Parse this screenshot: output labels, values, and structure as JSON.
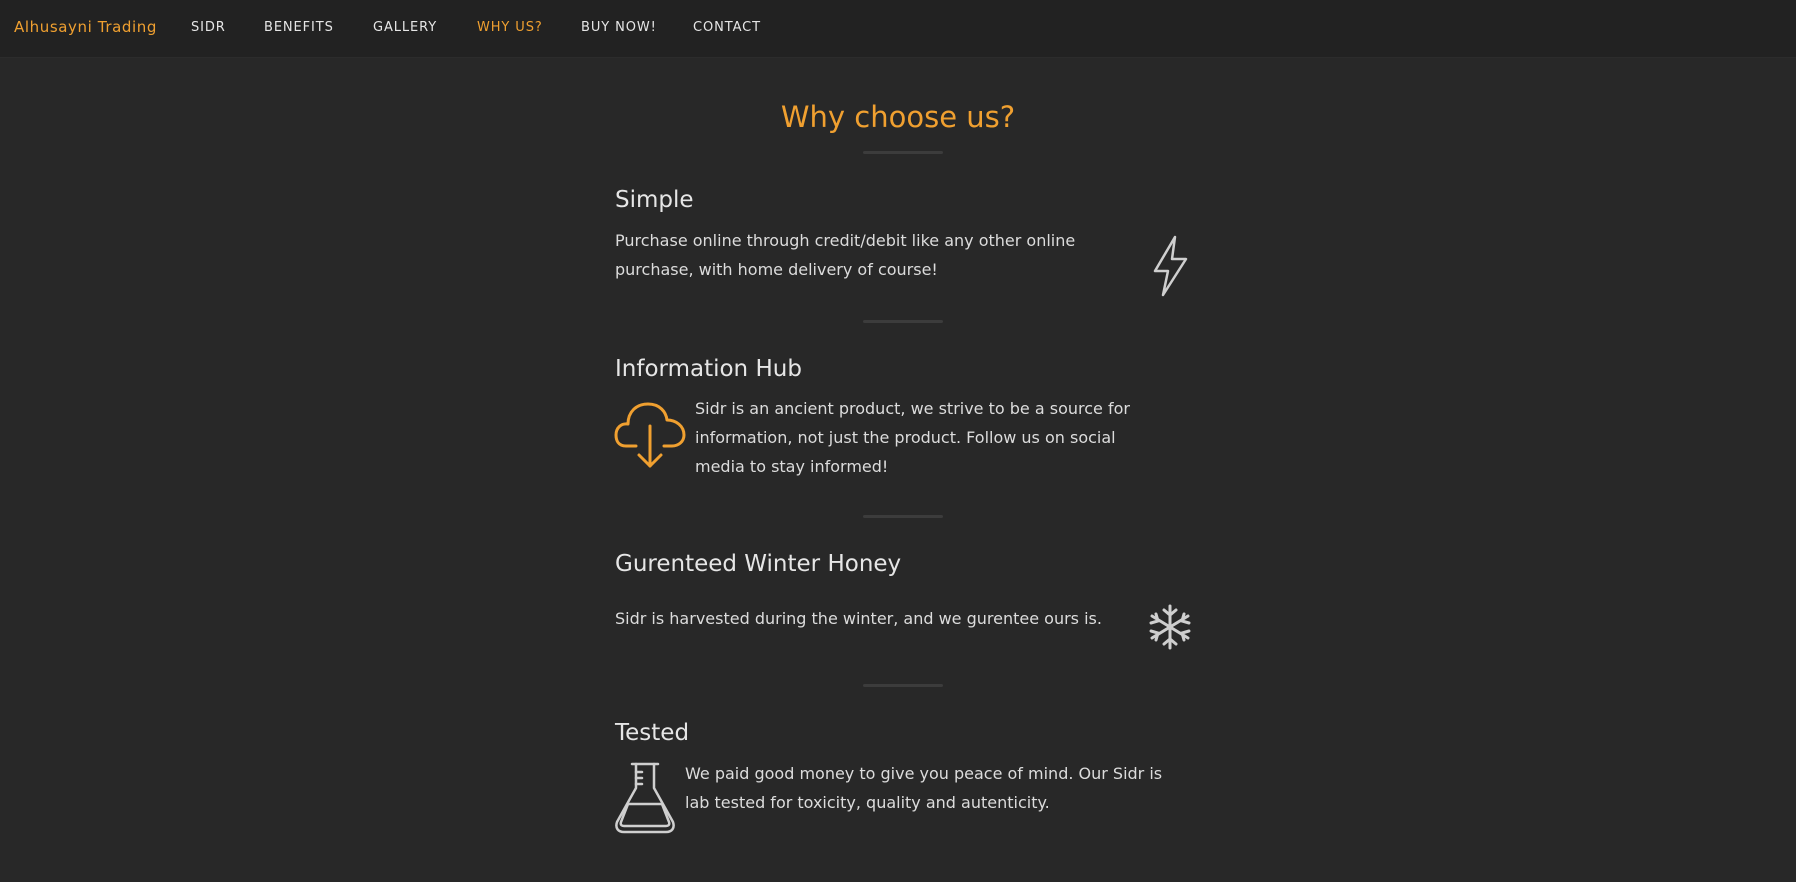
{
  "navbar": {
    "brand": "Alhusayni Trading",
    "items": [
      {
        "label": "SIDR",
        "active": false
      },
      {
        "label": "BENEFITS",
        "active": false
      },
      {
        "label": "GALLERY",
        "active": false
      },
      {
        "label": "WHY US?",
        "active": true
      },
      {
        "label": "BUY NOW!",
        "active": false
      },
      {
        "label": "CONTACT",
        "active": false
      }
    ]
  },
  "main": {
    "title": "Why choose us?",
    "sections": [
      {
        "title": "Simple",
        "text": "Purchase online through credit/debit like any other online purchase, with home delivery of course!",
        "icon": "lightning-icon"
      },
      {
        "title": "Information Hub",
        "text": "Sidr is an ancient product, we strive to be a source for information, not just the product. Follow us on social media to stay informed!",
        "icon": "cloud-download-icon"
      },
      {
        "title": "Gurenteed Winter Honey",
        "text": "Sidr is harvested during the winter, and we gurentee ours is.",
        "icon": "snowflake-icon"
      },
      {
        "title": "Tested",
        "text": "We paid good money to give you peace of mind. Our Sidr is lab tested for toxicity, quality and autenticity.",
        "icon": "flask-icon"
      }
    ]
  },
  "colors": {
    "accent": "#f0a030",
    "background": "#282828",
    "navbar": "#222222",
    "text": "#dcdcdc"
  }
}
